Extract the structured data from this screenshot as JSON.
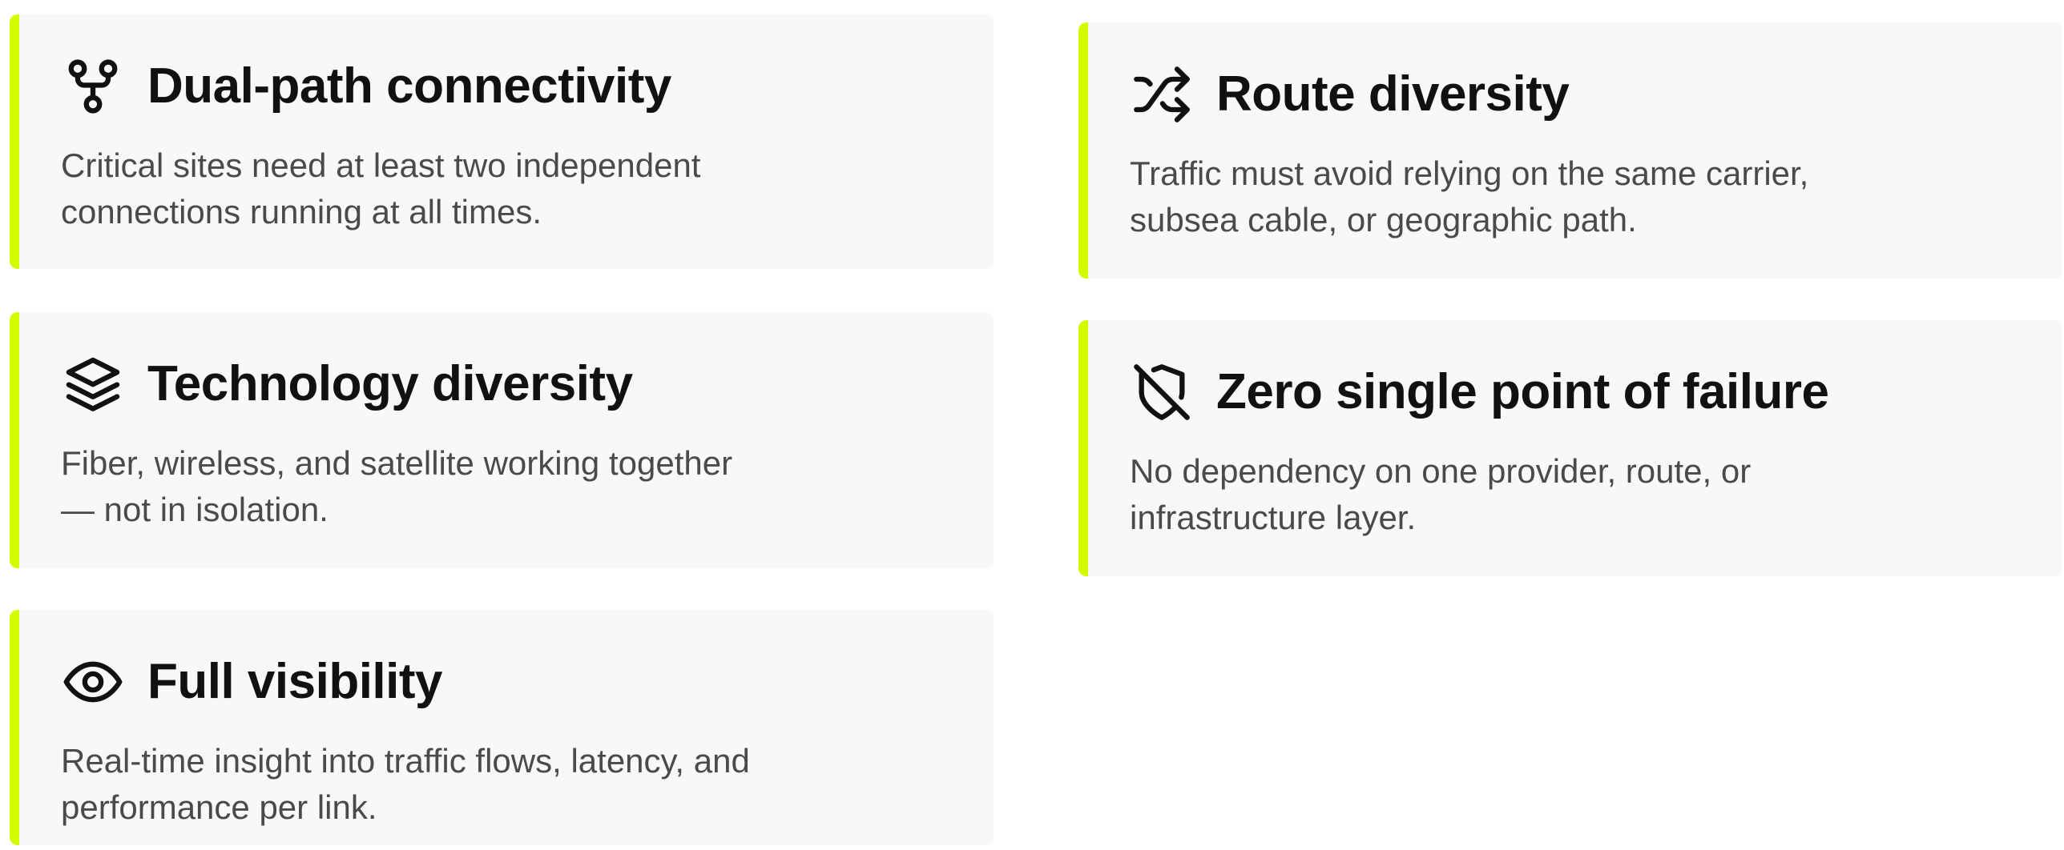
{
  "colors": {
    "accent": "#d4fa00",
    "card_background": "#f8f8f8",
    "title": "#111111",
    "body_text": "#4a4a4a"
  },
  "cards": [
    {
      "icon": "git-fork-icon",
      "title": "Dual-path connectivity",
      "lines": [
        "Critical sites need at least two independent",
        "connections running at all times."
      ]
    },
    {
      "icon": "shuffle-icon",
      "title": "Route diversity",
      "lines": [
        "Traffic must avoid relying on the same carrier,",
        "subsea cable, or geographic path."
      ]
    },
    {
      "icon": "layers-icon",
      "title": "Technology diversity",
      "lines": [
        "Fiber, wireless, and satellite working together",
        "— not in isolation."
      ]
    },
    {
      "icon": "shield-off-icon",
      "title": "Zero single point of failure",
      "lines": [
        "No dependency on one provider, route, or",
        "infrastructure layer."
      ]
    },
    {
      "icon": "eye-icon",
      "title": "Full visibility",
      "lines": [
        "Real-time insight into traffic flows, latency, and",
        "performance per link."
      ]
    }
  ]
}
